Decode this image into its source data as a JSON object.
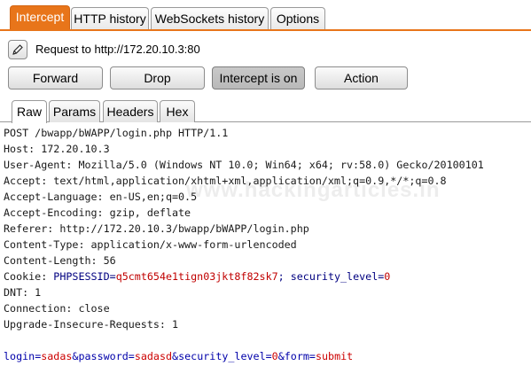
{
  "top_tabs": [
    {
      "label": "Intercept",
      "active": true
    },
    {
      "label": "HTTP history",
      "active": false
    },
    {
      "label": "WebSockets history",
      "active": false
    },
    {
      "label": "Options",
      "active": false
    }
  ],
  "request_info": {
    "icon": "pencil-edit-icon",
    "label": "Request to http://172.20.10.3:80"
  },
  "buttons": {
    "forward": "Forward",
    "drop": "Drop",
    "intercept": "Intercept is on",
    "action": "Action"
  },
  "view_tabs": [
    {
      "label": "Raw",
      "active": true
    },
    {
      "label": "Params",
      "active": false
    },
    {
      "label": "Headers",
      "active": false
    },
    {
      "label": "Hex",
      "active": false
    }
  ],
  "request": {
    "request_line": "POST /bwapp/bWAPP/login.php HTTP/1.1",
    "host": "Host: 172.20.10.3",
    "user_agent": "User-Agent: Mozilla/5.0 (Windows NT 10.0; Win64; x64; rv:58.0) Gecko/20100101",
    "accept": "Accept: text/html,application/xhtml+xml,application/xml;q=0.9,*/*;q=0.8",
    "accept_language": "Accept-Language: en-US,en;q=0.5",
    "accept_encoding": "Accept-Encoding: gzip, deflate",
    "referer": "Referer: http://172.20.10.3/bwapp/bWAPP/login.php",
    "content_type": "Content-Type: application/x-www-form-urlencoded",
    "content_length": "Content-Length: 56",
    "cookie": {
      "prefix": "Cookie: ",
      "name1": "PHPSESSID",
      "eq1": "=",
      "value1": "q5cmt654e1tign03jkt8f82sk7",
      "sep": "; ",
      "name2": "security_level",
      "eq2": "=",
      "value2": "0"
    },
    "dnt": "DNT: 1",
    "connection": "Connection: close",
    "upgrade": "Upgrade-Insecure-Requests: 1",
    "body": {
      "k1": "login",
      "v1": "sadas",
      "k2": "password",
      "v2": "sadasd",
      "k3": "security_level",
      "v3": "0",
      "k4": "form",
      "v4": "submit",
      "eq": "=",
      "amp": "&"
    }
  },
  "watermark": "www.hackingarticles.in",
  "colors": {
    "accent": "#e8751a",
    "param_name": "#000080",
    "param_value": "#c00000"
  }
}
